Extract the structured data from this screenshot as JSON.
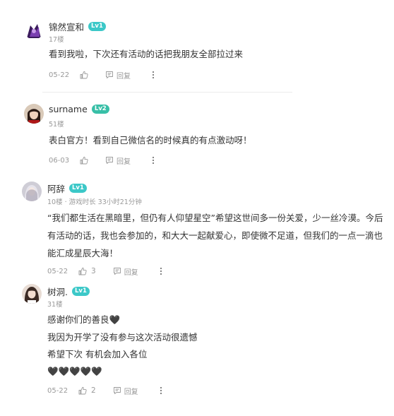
{
  "comments": [
    {
      "username": "锦然宣和",
      "level": "Lv1",
      "floor": "17楼",
      "text": "看到我啦，下次还有活动的话把我朋友全部拉过来",
      "date": "05-22",
      "reply_label": "回复"
    },
    {
      "username": "surname",
      "level": "Lv2",
      "floor": "51楼",
      "text": "表白官方！看到自己微信名的时候真的有点激动呀！",
      "date": "06-03",
      "reply_label": "回复"
    },
    {
      "username": "阿辞",
      "level": "Lv1",
      "floor_meta": "10楼 · 游戏时长 33小时21分钟",
      "text": "“我们都生活在黑暗里，但仍有人仰望星空”希望这世间多一份关爱，少一丝冷漠。今后有活动的话，我也会参加的，和大大一起献爱心，即使微不足道，但我们的一点一滴也能汇成星辰大海！",
      "date": "05-22",
      "like_count": "3",
      "reply_label": "回复"
    },
    {
      "username": "树洞.",
      "level": "Lv1",
      "floor": "31楼",
      "lines": [
        "感谢你们的善良🖤",
        "我因为开学了没有参与这次活动很遗憾",
        "希望下次  有机会加入各位",
        "🖤🖤🖤🖤🖤"
      ],
      "date": "05-22",
      "like_count": "2",
      "reply_label": "回复"
    }
  ],
  "colors": {
    "level_badge": "#3cc8c8",
    "level_badge_lv2": "#38bfa7",
    "muted_text": "#999999",
    "body_text": "#333333",
    "divider": "#ececec"
  },
  "icons": [
    "thumbs-up-icon",
    "comment-reply-icon",
    "more-vertical-icon"
  ]
}
